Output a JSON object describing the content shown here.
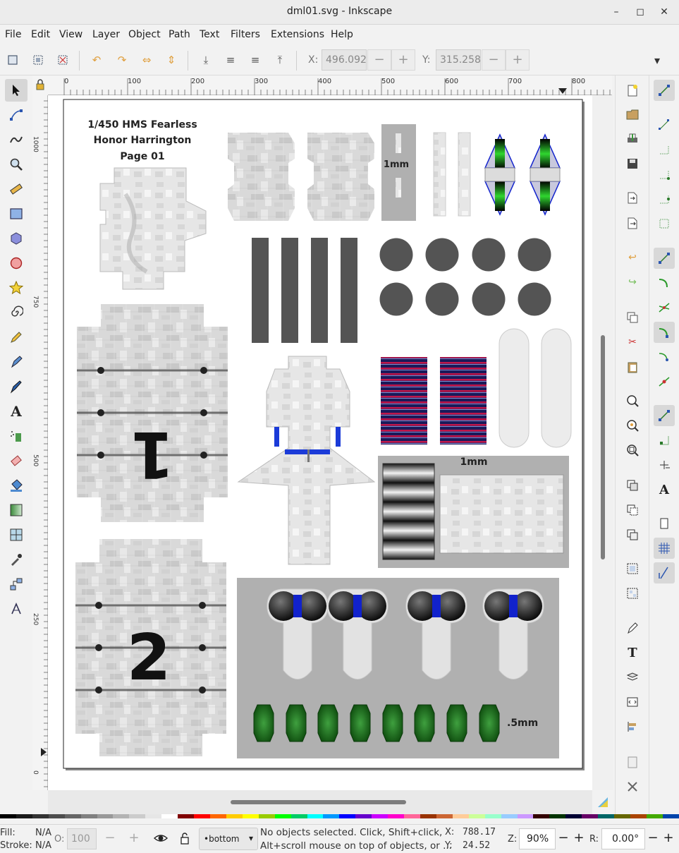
{
  "window": {
    "title": "dml01.svg - Inkscape",
    "minimize_glyph": "–",
    "maximize_glyph": "◻",
    "close_glyph": "✕"
  },
  "menu": [
    "File",
    "Edit",
    "View",
    "Layer",
    "Object",
    "Path",
    "Text",
    "Filters",
    "Extensions",
    "Help"
  ],
  "toolbar": {
    "x_label": "X:",
    "x_value": "496.092",
    "y_label": "Y:",
    "y_value": "315.258",
    "minus": "−",
    "plus": "+",
    "overflow_glyph": "▾"
  },
  "ruler": {
    "h_ticks": [
      "0",
      "100",
      "200",
      "300",
      "400",
      "500",
      "600",
      "700",
      "800"
    ],
    "v_ticks": [
      "1000",
      "750",
      "500",
      "250",
      "0"
    ]
  },
  "document": {
    "title_lines": [
      "1/450 HMS Fearless",
      "Honor Harrington",
      "Page 01"
    ],
    "label_1mm_a": "1mm",
    "label_1mm_b": "1mm",
    "label_half_mm": ".5mm",
    "numeral_1": "1",
    "numeral_2": "2"
  },
  "colors": {
    "accent_green": "#2fd62f",
    "accent_blue": "#1122cc",
    "dark_gray": "#545454",
    "stripe_red": "#c0164a",
    "stripe_navy": "#1a1a5a",
    "leaf_green": "#1f7a1f"
  },
  "status": {
    "fill_label": "Fill:",
    "fill_value": "N/A",
    "stroke_label": "Stroke:",
    "stroke_value": "N/A",
    "opacity_label": "O:",
    "opacity_value": "100",
    "layer_name": "•bottom",
    "message_line1": "No objects selected. Click, Shift+click,",
    "message_line2": "Alt+scroll mouse on top of objects, or ...",
    "cursor_x_label": "X:",
    "cursor_x": "788.17",
    "cursor_y_label": "Y:",
    "cursor_y": "24.52",
    "zoom_label": "Z:",
    "zoom": "90%",
    "rotate_label": "R:",
    "rotation": "0.00°"
  }
}
